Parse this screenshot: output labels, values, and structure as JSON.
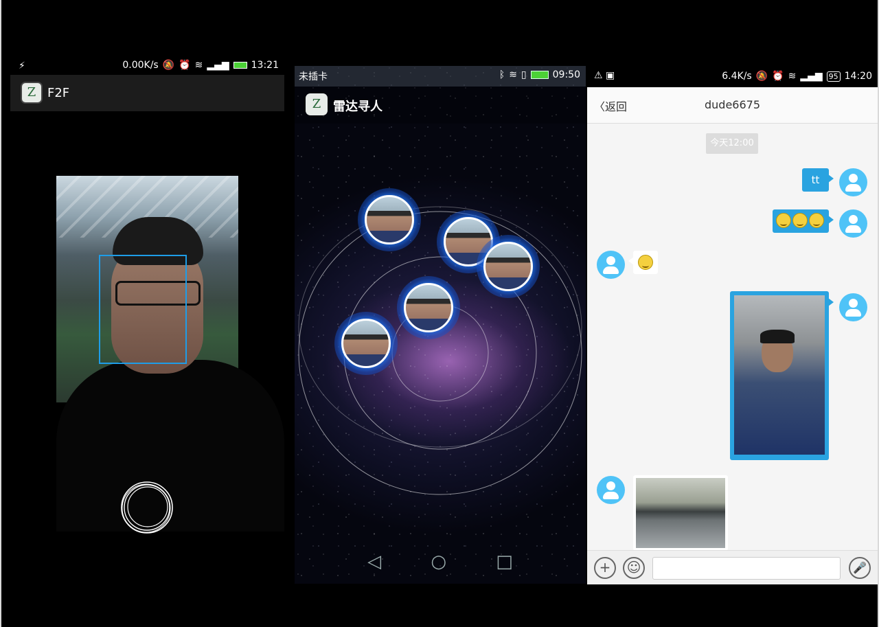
{
  "phone1": {
    "status": {
      "speed": "0.00K/s",
      "time": "13:21"
    },
    "app_title": "F2F",
    "logo_glyph": "Z",
    "accent_color": "#1e9de8"
  },
  "phone2": {
    "status": {
      "carrier": "未插卡",
      "time": "09:50"
    },
    "app_title": "雷达寻人",
    "logo_glyph": "Z",
    "nav": {
      "back": "◁",
      "home": "○",
      "recent": "□"
    }
  },
  "phone3": {
    "status": {
      "speed": "6.4K/s",
      "battery": "95",
      "time": "14:20"
    },
    "back_label": "返回",
    "chat_title": "dude6675",
    "timestamp": "今天12:00",
    "messages": {
      "m1_text": "tt"
    },
    "input": {
      "plus": "+",
      "emoji": "☺",
      "mic": "🎤"
    },
    "accent_color": "#2aa3e0"
  }
}
